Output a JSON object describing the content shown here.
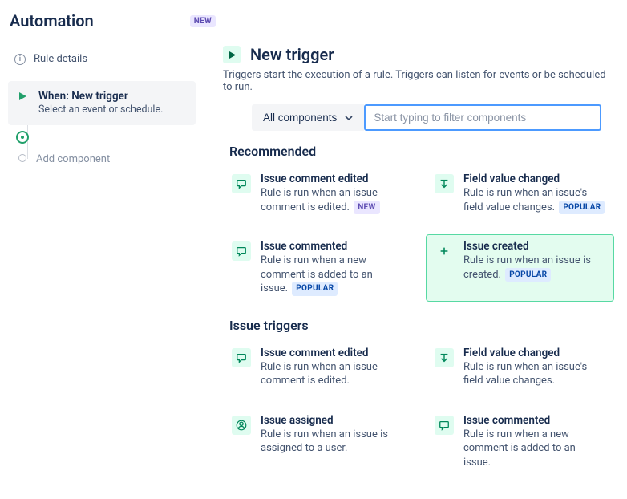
{
  "header": {
    "title": "Automation",
    "badge": "NEW"
  },
  "sidebar": {
    "rule_details": "Rule details",
    "steps": [
      {
        "title": "When: New trigger",
        "subtitle": "Select an event or schedule."
      }
    ],
    "add_component": "Add component"
  },
  "main": {
    "title": "New trigger",
    "description": "Triggers start the execution of a rule. Triggers can listen for events or be scheduled to run.",
    "filter": {
      "dropdown_label": "All components",
      "search_placeholder": "Start typing to filter components"
    },
    "sections": [
      {
        "title": "Recommended",
        "items": [
          {
            "icon": "comment",
            "title": "Issue comment edited",
            "desc": "Rule is run when an issue comment is edited.",
            "badge": "NEW",
            "badge_kind": "new",
            "highlight": false
          },
          {
            "icon": "field",
            "title": "Field value changed",
            "desc": "Rule is run when an issue's field value changes.",
            "badge": "POPULAR",
            "badge_kind": "popular",
            "highlight": false
          },
          {
            "icon": "comment",
            "title": "Issue commented",
            "desc": "Rule is run when a new comment is added to an issue.",
            "badge": "POPULAR",
            "badge_kind": "popular",
            "highlight": false
          },
          {
            "icon": "plus",
            "title": "Issue created",
            "desc": "Rule is run when an issue is created.",
            "badge": "POPULAR",
            "badge_kind": "popular",
            "highlight": true
          }
        ]
      },
      {
        "title": "Issue triggers",
        "items": [
          {
            "icon": "comment",
            "title": "Issue comment edited",
            "desc": "Rule is run when an issue comment is edited.",
            "badge": null,
            "highlight": false
          },
          {
            "icon": "field",
            "title": "Field value changed",
            "desc": "Rule is run when an issue's field value changes.",
            "badge": null,
            "highlight": false
          },
          {
            "icon": "user",
            "title": "Issue assigned",
            "desc": "Rule is run when an issue is assigned to a user.",
            "badge": null,
            "highlight": false
          },
          {
            "icon": "comment",
            "title": "Issue commented",
            "desc": "Rule is run when a new comment is added to an issue.",
            "badge": null,
            "highlight": false
          }
        ]
      }
    ]
  }
}
